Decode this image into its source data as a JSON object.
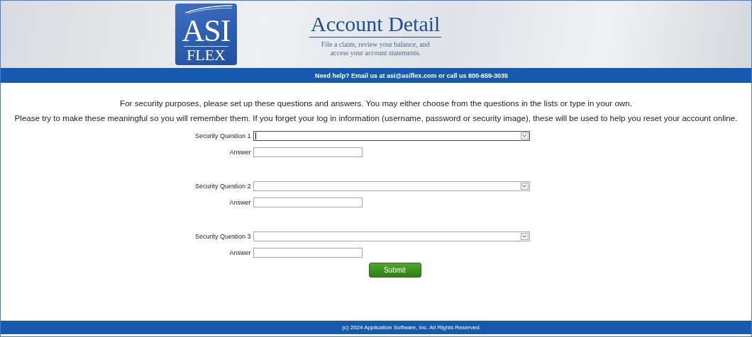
{
  "header": {
    "logo_top": "ASI",
    "logo_bottom": "FLEX",
    "title": "Account Detail",
    "subtitle_lines": [
      "File a claim, review your balance, and",
      "access your account statements."
    ]
  },
  "help_bar": "Need help? Email us at asi@asiflex.com or call us 800-659-3035",
  "intro": [
    "For security purposes, please set up these questions and answers. You may either choose from the questions in the lists or type in your own.",
    "Please try to make these meaningful so you will remember them. If you forget your log in information (username, password or security image), these will be used to help you reset your account online."
  ],
  "questions": [
    {
      "label": "Security Question 1",
      "focused": true,
      "answer_label": "Answer"
    },
    {
      "label": "Security Question 2",
      "focused": false,
      "answer_label": "Answer"
    },
    {
      "label": "Security Question 3",
      "focused": false,
      "answer_label": "Answer"
    }
  ],
  "submit": "Submit",
  "footer": "(c) 2024 Application Software, Inc.  All Rights Reserved."
}
